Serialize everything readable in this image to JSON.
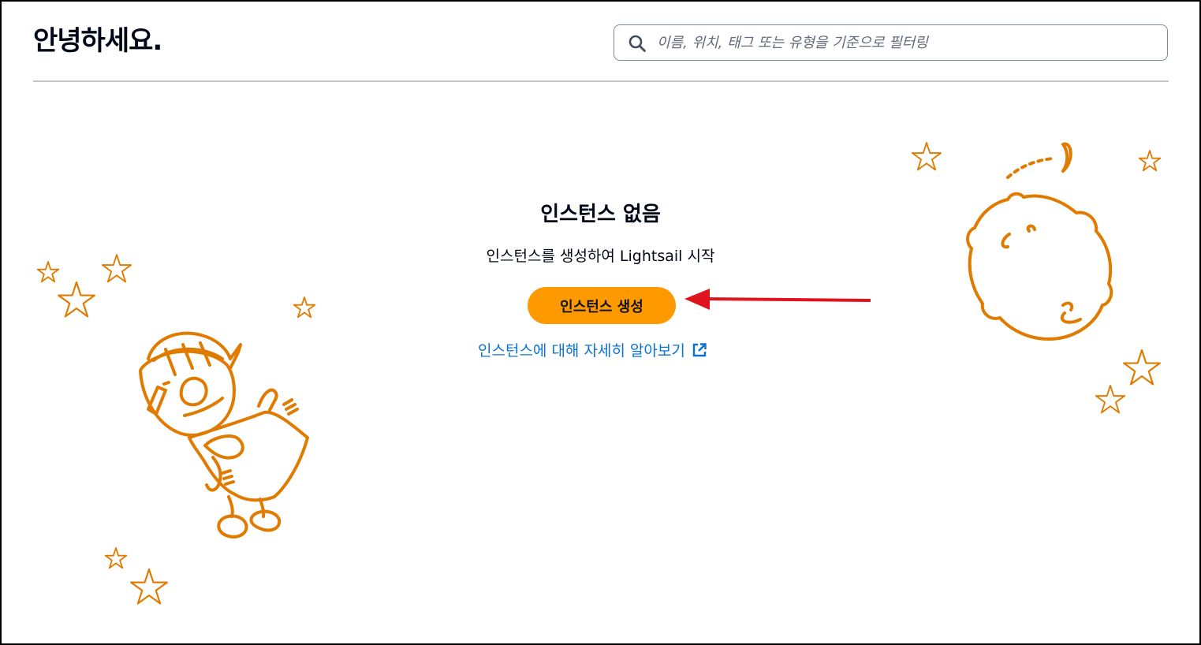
{
  "header": {
    "title": "안녕하세요."
  },
  "search": {
    "placeholder": "이름, 위치, 태그 또는 유형을 기준으로 필터링",
    "value": ""
  },
  "empty_state": {
    "title": "인스턴스 없음",
    "description": "인스턴스를 생성하여 Lightsail 시작",
    "create_button_label": "인스턴스 생성",
    "learn_more_label": "인스턴스에 대해 자세히 알아보기"
  },
  "colors": {
    "accent": "#ff9900",
    "link": "#0972d3",
    "illustration": "#e07b00",
    "arrow": "#e0141e"
  }
}
